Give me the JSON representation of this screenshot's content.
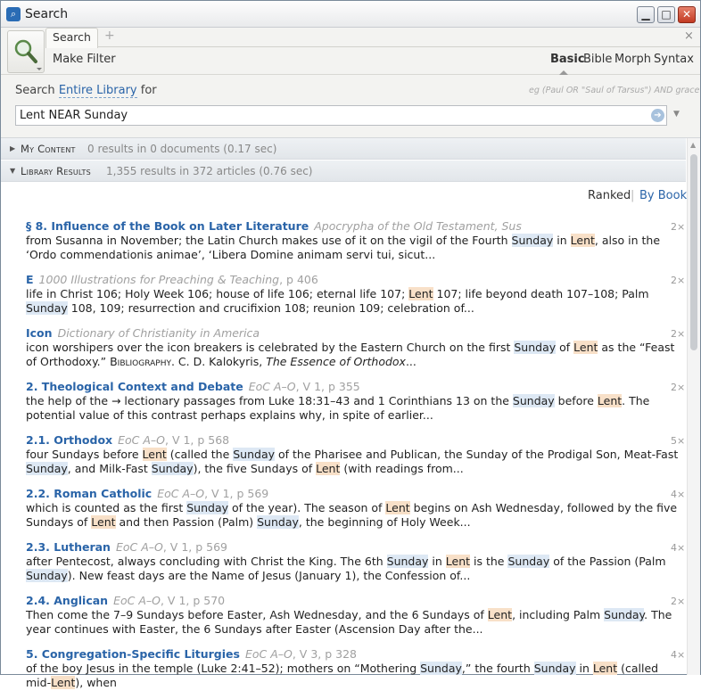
{
  "window": {
    "title": "Search",
    "minimize": "▁",
    "maximize": "□",
    "close": "✕"
  },
  "toolbar": {
    "tab_label": "Search",
    "tab_plus": "+",
    "tab_close": "×",
    "make_filter": "Make Filter",
    "modes": [
      "Basic",
      "Bible",
      "Morph",
      "Syntax"
    ]
  },
  "query": {
    "label_prefix": "Search",
    "scope": "Entire Library",
    "label_suffix": "for",
    "example": "eg (Paul OR \"Saul of Tarsus\") AND grace",
    "value": "Lent NEAR Sunday"
  },
  "sections": {
    "my_content": {
      "name": "My Content",
      "stat": "0 results in 0 documents (0.17 sec)"
    },
    "library": {
      "name": "Library Results",
      "stat": "1,355 results in 372 articles (0.76 sec)"
    }
  },
  "sort": {
    "ranked": "Ranked",
    "separator": "|",
    "by_book": "By Book"
  },
  "icons": {
    "app": "search-window-icon",
    "magnifier": "magnifier-icon",
    "go": "go-arrow-icon",
    "collapse": "triangle-down-icon"
  },
  "colors": {
    "link": "#2a64a8",
    "highlight_sunday": "#dde8f4",
    "highlight_lent": "#f8e0c8"
  },
  "results": [
    {
      "heading": "§ 8. Influence of the Book on Later Literature",
      "source": "Apocrypha of the Old Testament, Sus",
      "ref": "",
      "count": "2×",
      "snippet": [
        [
          "t",
          "from Susanna in November; the Latin Church makes use of it on the vigil of the Fourth "
        ],
        [
          "s",
          "Sunday"
        ],
        [
          "t",
          " in "
        ],
        [
          "l",
          "Lent"
        ],
        [
          "t",
          ", also in the ‘Ordo commendationis animae’, ‘Libera Domine animam servi tui, sicut..."
        ]
      ]
    },
    {
      "heading": "E",
      "source": "1000 Illustrations for Preaching & Teaching",
      "ref": ", p 406",
      "count": "2×",
      "snippet": [
        [
          "t",
          "life in Christ 106; Holy Week 106; house of life 106; eternal life 107; "
        ],
        [
          "l",
          "Lent"
        ],
        [
          "t",
          " 107; life beyond death 107–108; Palm "
        ],
        [
          "s",
          "Sunday"
        ],
        [
          "t",
          " 108, 109; resurrection and crucifixion 108; reunion 109; celebration of..."
        ]
      ]
    },
    {
      "heading": "Icon",
      "source": "Dictionary of Christianity in America",
      "ref": "",
      "count": "2×",
      "snippet": [
        [
          "t",
          "icon worshipers over the icon breakers is celebrated by the Eastern Church on the first "
        ],
        [
          "s",
          "Sunday"
        ],
        [
          "t",
          " of "
        ],
        [
          "l",
          "Lent"
        ],
        [
          "t",
          " as the “Feast of Orthodoxy.” "
        ],
        [
          "c",
          "Bibliography"
        ],
        [
          "t",
          ". C. D. Kalokyris, "
        ],
        [
          "i",
          "The Essence of Orthodox"
        ],
        [
          "t",
          "..."
        ]
      ]
    },
    {
      "heading": "2. Theological Context and Debate",
      "source": "EoC A–O",
      "ref": ", V 1, p 355",
      "count": "2×",
      "snippet": [
        [
          "t",
          "the help of the → lectionary passages from Luke 18:31–43 and 1 Corinthians 13 on the "
        ],
        [
          "s",
          "Sunday"
        ],
        [
          "t",
          " before "
        ],
        [
          "l",
          "Lent"
        ],
        [
          "t",
          ". The potential value of this contrast perhaps explains why, in spite of earlier..."
        ]
      ]
    },
    {
      "heading": "2.1. Orthodox",
      "source": "EoC A–O",
      "ref": ", V 1, p 568",
      "count": "5×",
      "snippet": [
        [
          "t",
          "four Sundays before "
        ],
        [
          "l",
          "Lent"
        ],
        [
          "t",
          " (called the "
        ],
        [
          "s",
          "Sunday"
        ],
        [
          "t",
          " of the Pharisee and Publican, the Sunday of the Prodigal Son, Meat-Fast "
        ],
        [
          "s",
          "Sunday"
        ],
        [
          "t",
          ", and Milk-Fast "
        ],
        [
          "s",
          "Sunday"
        ],
        [
          "t",
          "), the five Sundays of "
        ],
        [
          "l",
          "Lent"
        ],
        [
          "t",
          " (with readings from..."
        ]
      ]
    },
    {
      "heading": "2.2. Roman Catholic",
      "source": "EoC A–O",
      "ref": ", V 1, p 569",
      "count": "4×",
      "snippet": [
        [
          "t",
          "which is counted as the first "
        ],
        [
          "s",
          "Sunday"
        ],
        [
          "t",
          " of the year). The season of "
        ],
        [
          "l",
          "Lent"
        ],
        [
          "t",
          " begins on Ash Wednesday, followed by the five Sundays of "
        ],
        [
          "l",
          "Lent"
        ],
        [
          "t",
          " and then Passion (Palm) "
        ],
        [
          "s",
          "Sunday"
        ],
        [
          "t",
          ", the beginning of Holy Week..."
        ]
      ]
    },
    {
      "heading": "2.3. Lutheran",
      "source": "EoC A–O",
      "ref": ", V 1, p 569",
      "count": "4×",
      "snippet": [
        [
          "t",
          "after Pentecost, always concluding with Christ the King. The 6th "
        ],
        [
          "s",
          "Sunday"
        ],
        [
          "t",
          " in "
        ],
        [
          "l",
          "Lent"
        ],
        [
          "t",
          " is the "
        ],
        [
          "s",
          "Sunday"
        ],
        [
          "t",
          " of the Passion (Palm "
        ],
        [
          "s",
          "Sunday"
        ],
        [
          "t",
          "). New feast days are the Name of Jesus (January 1), the Confession of..."
        ]
      ]
    },
    {
      "heading": "2.4. Anglican",
      "source": "EoC A–O",
      "ref": ", V 1, p 570",
      "count": "2×",
      "snippet": [
        [
          "t",
          "Then come the 7–9 Sundays before Easter, Ash Wednesday, and the 6 Sundays of "
        ],
        [
          "l",
          "Lent"
        ],
        [
          "t",
          ", including Palm "
        ],
        [
          "s",
          "Sunday"
        ],
        [
          "t",
          ". The year continues with Easter, the 6 Sundays after Easter (Ascension Day after the..."
        ]
      ]
    },
    {
      "heading": "5. Congregation-Specific Liturgies",
      "source": "EoC A–O",
      "ref": ", V 3, p 328",
      "count": "4×",
      "snippet": [
        [
          "t",
          "of the boy Jesus in the temple (Luke 2:41–52); mothers on “Mothering "
        ],
        [
          "s",
          "Sunday"
        ],
        [
          "t",
          ",” the fourth "
        ],
        [
          "s",
          "Sunday"
        ],
        [
          "t",
          " in "
        ],
        [
          "l",
          "Lent"
        ],
        [
          "t",
          " (called mid-"
        ],
        [
          "l",
          "Lent"
        ],
        [
          "t",
          "), when"
        ]
      ]
    }
  ]
}
